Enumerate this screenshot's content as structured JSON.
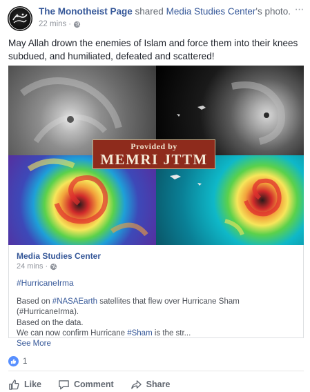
{
  "header": {
    "page_name": "The Monotheist Page",
    "shared_text": "shared",
    "shared_source": "Media Studies Center",
    "shared_suffix": "'s photo.",
    "time": "22 mins",
    "separator": "·",
    "more_label": "···"
  },
  "post": {
    "text": "May Allah drown the enemies of Islam and force them into their knees subdued, and humiliated, defeated and scattered!"
  },
  "watermark": {
    "line1": "Provided by",
    "line2": "MEMRI JTTM"
  },
  "shared_post": {
    "author": "Media Studies Center",
    "time": "24 mins",
    "separator": "·",
    "hashtag": "#HurricaneIrma",
    "line1_pre": "Based on ",
    "line1_link": "#NASAEarth",
    "line1_post": " satellites that flew over Hurricane Sham (#HurricaneIrma).",
    "line2": "Based on the data.",
    "line3_pre": "We can now confirm Hurricane ",
    "line3_link": "#Sham",
    "line3_post": " is the str...",
    "see_more": "See More"
  },
  "reactions": {
    "count": "1"
  },
  "actions": {
    "like": "Like",
    "comment": "Comment",
    "share": "Share"
  },
  "colors": {
    "link": "#365899",
    "meta": "#90949c",
    "like_blue": "#5890ff",
    "watermark_bg": "#8e2b1c"
  },
  "icons": [
    "avatar-emblem-icon",
    "globe-icon",
    "like-reaction-icon",
    "thumbs-up-icon",
    "comment-icon",
    "share-arrow-icon"
  ]
}
